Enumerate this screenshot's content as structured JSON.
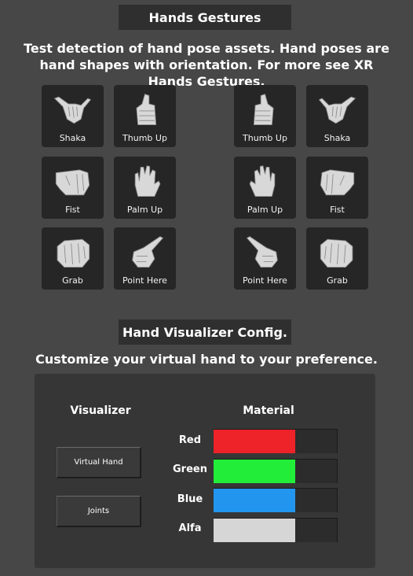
{
  "gestures_section": {
    "title": "Hands Gestures",
    "description": "Test detection of hand pose assets. Hand poses are hand shapes with orientation. For more see XR Hands Gestures."
  },
  "left_hand_poses": [
    {
      "label": "Shaka",
      "icon": "shaka-hand-icon"
    },
    {
      "label": "Thumb Up",
      "icon": "thumb-up-hand-icon"
    },
    {
      "label": "Fist",
      "icon": "fist-hand-icon"
    },
    {
      "label": "Palm Up",
      "icon": "palm-up-hand-icon"
    },
    {
      "label": "Grab",
      "icon": "grab-hand-icon"
    },
    {
      "label": "Point Here",
      "icon": "point-here-hand-icon"
    }
  ],
  "right_hand_poses": [
    {
      "label": "Thumb Up",
      "icon": "thumb-up-hand-icon"
    },
    {
      "label": "Shaka",
      "icon": "shaka-hand-icon"
    },
    {
      "label": "Palm Up",
      "icon": "palm-up-hand-icon"
    },
    {
      "label": "Fist",
      "icon": "fist-hand-icon"
    },
    {
      "label": "Point Here",
      "icon": "point-here-hand-icon"
    },
    {
      "label": "Grab",
      "icon": "grab-hand-icon"
    }
  ],
  "visualizer_section": {
    "title": "Hand Visualizer Config.",
    "description": "Customize your virtual hand to your preference.",
    "visualizer_heading": "Visualizer",
    "material_heading": "Material",
    "buttons": [
      {
        "label": "Virtual Hand"
      },
      {
        "label": "Joints"
      }
    ],
    "material_sliders": [
      {
        "label": "Red",
        "color": "#ee2229",
        "value": 0.66
      },
      {
        "label": "Green",
        "color": "#22ee3a",
        "value": 0.66
      },
      {
        "label": "Blue",
        "color": "#2296ee",
        "value": 0.66
      },
      {
        "label": "Alfa",
        "color": "#d6d6d6",
        "value": 0.66
      }
    ]
  }
}
